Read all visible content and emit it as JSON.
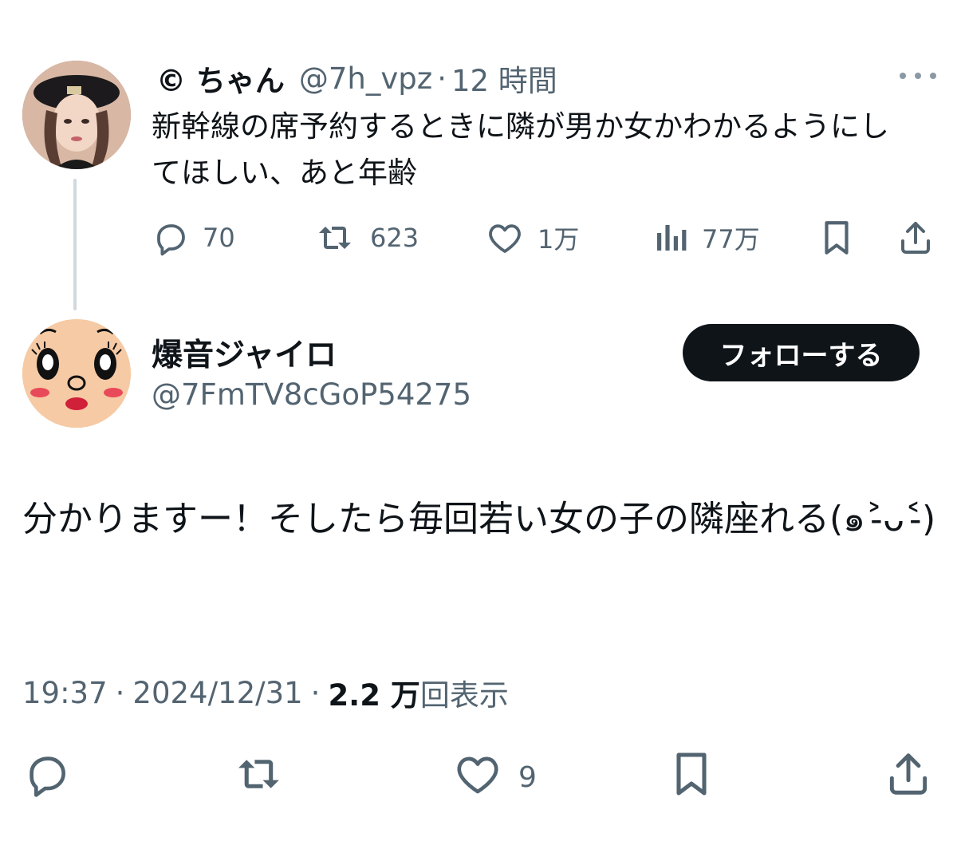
{
  "parent_tweet": {
    "display_name": "© ちゃん",
    "handle": "@7h_vpz",
    "separator": "·",
    "time": "12 時間",
    "body": "新幹線の席予約するときに隣が男か女かわかるようにしてほしい、あと年齢",
    "actions": {
      "replies": "70",
      "reposts": "623",
      "likes": "1万",
      "views": "77万"
    }
  },
  "reply_tweet": {
    "display_name": "爆音ジャイロ",
    "handle": "@7FmTV8cGoP54275",
    "follow_label": "フォローする",
    "body": "分かりますー！そしたら毎回若い女の子の隣座れる(๑˃̵ᴗ˂̵)",
    "meta": {
      "time": "19:37",
      "separator": "·",
      "date": "2024/12/31",
      "views_count": "2.2 万",
      "views_label": "回表示"
    },
    "actions": {
      "likes": "9"
    }
  },
  "colors": {
    "text_primary": "#0f1419",
    "text_secondary": "#536471",
    "thread_line": "#cfd9de",
    "button_bg": "#0f1419"
  },
  "icons": [
    "more-icon",
    "reply-icon",
    "repost-icon",
    "like-icon",
    "views-icon",
    "bookmark-icon",
    "share-icon"
  ]
}
